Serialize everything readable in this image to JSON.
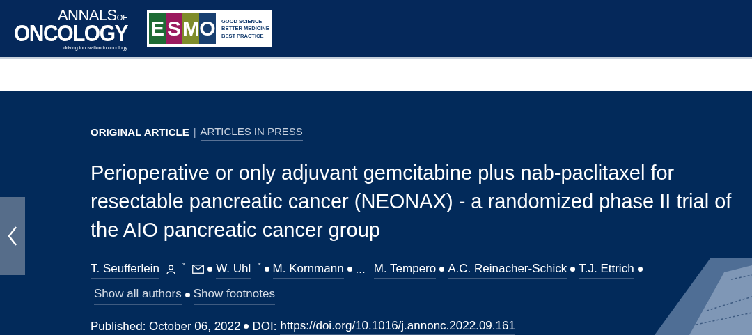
{
  "header": {
    "journal_logo": {
      "name_top": "ANNALS",
      "name_of": "OF",
      "name_main": "ONCOLOGY",
      "tagline": "driving innovation in oncology"
    },
    "partner_logo": {
      "letters": [
        {
          "text": "E",
          "color": "#1e6b34"
        },
        {
          "text": "S",
          "color": "#9b1a5e"
        },
        {
          "text": "M",
          "color": "#7f8c2a"
        },
        {
          "text": "O",
          "color": "#183f70"
        }
      ],
      "taglines": [
        "GOOD SCIENCE",
        "BETTER MEDICINE",
        "BEST PRACTICE"
      ]
    }
  },
  "article": {
    "category": "ORIGINAL ARTICLE",
    "divider": "|",
    "status": "ARTICLES IN PRESS",
    "title": "Perioperative or only adjuvant gemcitabine plus nab-paclitaxel for resectable pancreatic cancer (NEONAX) - a randomized phase II trial of the AIO pancreatic cancer group",
    "authors": [
      {
        "kind": "author",
        "name": "T. Seufferlein",
        "corresponding": true,
        "mark": "*",
        "email": true
      },
      {
        "kind": "author",
        "name": "W. Uhl",
        "corresponding": false,
        "mark": "*",
        "email": false
      },
      {
        "kind": "author",
        "name": "M. Kornmann",
        "corresponding": false,
        "email": false
      },
      {
        "kind": "ellipsis",
        "text": "..."
      },
      {
        "kind": "author",
        "name": "M. Tempero",
        "corresponding": false,
        "email": false
      },
      {
        "kind": "author",
        "name": "A.C. Reinacher-Schick",
        "corresponding": false,
        "email": false
      },
      {
        "kind": "author",
        "name": "T.J. Ettrich",
        "corresponding": false,
        "email": false
      }
    ],
    "author_links": [
      "Show all authors",
      "Show footnotes"
    ],
    "published": "Published: October 06, 2022",
    "doi_label": "DOI:",
    "doi": "https://doi.org/10.1016/j.annonc.2022.09.161"
  }
}
